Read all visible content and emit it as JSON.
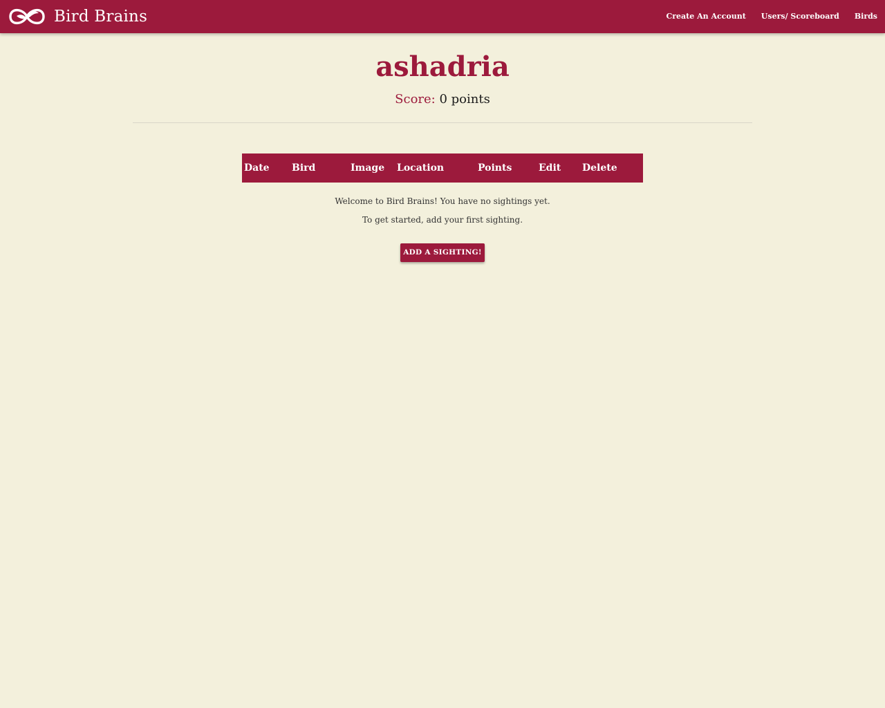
{
  "app": {
    "brand_name": "Bird Brains",
    "logo_icon": "bird-logo-icon"
  },
  "nav": {
    "links": [
      {
        "label": "Create An Account"
      },
      {
        "label": "Users/ Scoreboard"
      },
      {
        "label": "Birds"
      }
    ]
  },
  "profile": {
    "username": "ashadria",
    "score_label": "Score:",
    "score_value": "0 points"
  },
  "sightings_table": {
    "columns": [
      "Date",
      "Bird",
      "Image",
      "Location",
      "Points",
      "Edit",
      "Delete"
    ]
  },
  "empty_state": {
    "line1": "Welcome to Bird Brains! You have no sightings yet.",
    "line2": "To get started, add your first sighting.",
    "button_label": "ADD A SIGHTING!"
  },
  "colors": {
    "primary": "#9c1a3c",
    "background": "#f3f0dc"
  }
}
